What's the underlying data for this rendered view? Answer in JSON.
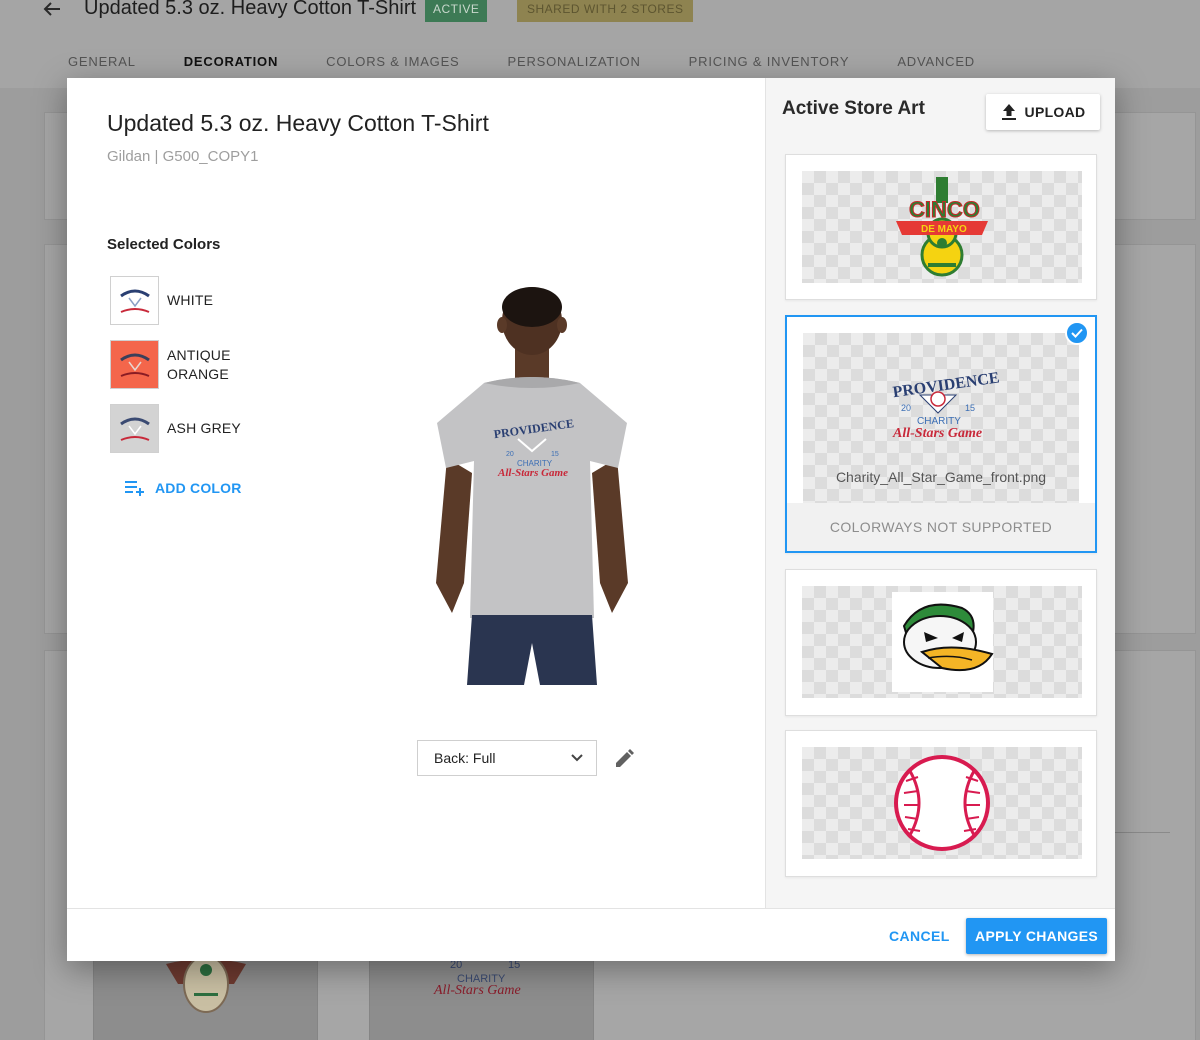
{
  "background": {
    "title": "Updated 5.3 oz. Heavy Cotton T-Shirt",
    "status_badge": "ACTIVE",
    "shared_badge": "SHARED WITH 2 STORES",
    "tabs": [
      {
        "label": "GENERAL",
        "active": false
      },
      {
        "label": "DECORATION",
        "active": true
      },
      {
        "label": "COLORS & IMAGES",
        "active": false
      },
      {
        "label": "PERSONALIZATION",
        "active": false
      },
      {
        "label": "PRICING & INVENTORY",
        "active": false
      },
      {
        "label": "ADVANCED",
        "active": false
      }
    ],
    "thumb_text": {
      "charity": "CHARITY",
      "game": "All-Stars Game",
      "year_left": "20",
      "year_right": "15"
    }
  },
  "modal": {
    "product_title": "Updated 5.3 oz. Heavy Cotton T-Shirt",
    "product_subtitle": "Gildan | G500_COPY1",
    "selected_colors_label": "Selected Colors",
    "colors": [
      {
        "name": "WHITE",
        "hex": "#ffffff"
      },
      {
        "name": "ANTIQUE ORANGE",
        "hex": "#f4664b"
      },
      {
        "name": "ASH GREY",
        "hex": "#d3d3d3"
      }
    ],
    "add_color_label": "ADD COLOR",
    "view_select": {
      "value": "Back: Full"
    },
    "shirt_color": "#c3c3c5",
    "logo": {
      "top": "PROVIDENCE",
      "year_left": "20",
      "year_right": "15",
      "mid": "CHARITY",
      "script": "All-Stars Game"
    },
    "art_panel": {
      "title": "Active Store Art",
      "upload_label": "UPLOAD",
      "items": [
        {
          "name": "cinco-de-mayo-art",
          "top_text": "CINCO",
          "banner_text": "DE MAYO",
          "selected": false
        },
        {
          "name": "charity-all-star-art",
          "file_name": "Charity_All_Star_Game_front.png",
          "notice": "COLORWAYS NOT SUPPORTED",
          "selected": true
        },
        {
          "name": "duck-mascot-art",
          "selected": false
        },
        {
          "name": "baseball-art",
          "selected": false
        }
      ]
    },
    "footer": {
      "cancel_label": "CANCEL",
      "apply_label": "APPLY CHANGES"
    },
    "accent_color": "#2196f3"
  }
}
